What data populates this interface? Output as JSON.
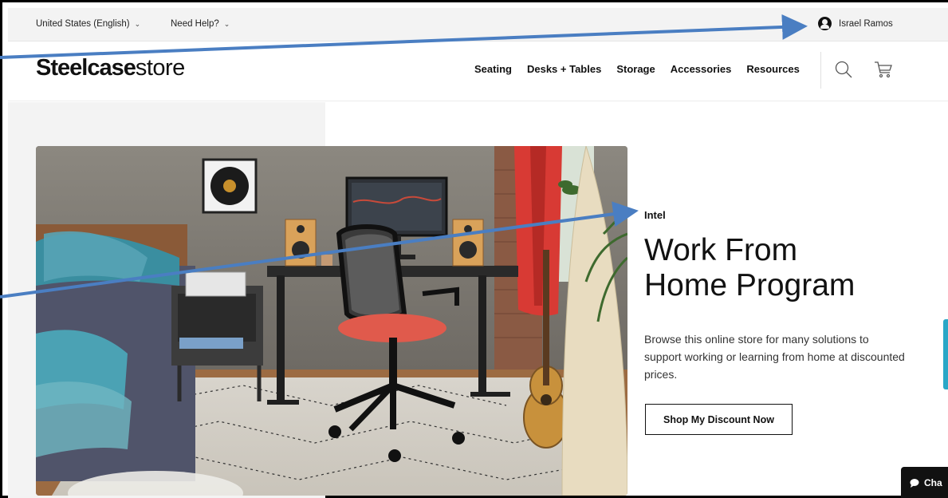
{
  "utility_bar": {
    "region": "United States (English)",
    "help": "Need Help?",
    "user_name": "Israel Ramos"
  },
  "header": {
    "logo_brand": "Steelcase",
    "logo_store": "store",
    "nav": [
      "Seating",
      "Desks + Tables",
      "Storage",
      "Accessories",
      "Resources"
    ],
    "icons": [
      "search-icon",
      "cart-icon"
    ]
  },
  "hero": {
    "eyebrow": "Intel",
    "title_line1": "Work From",
    "title_line2": "Home Program",
    "description": "Browse this online store for many solutions to support working or learning from home at discounted prices.",
    "cta": "Shop My Discount Now"
  },
  "chat": {
    "label": "Cha"
  },
  "colors": {
    "annotation_arrow": "#4a7ec2",
    "side_tab": "#2aa7c7",
    "chair_seat": "#e05a4c",
    "curtain": "#d83a34"
  }
}
